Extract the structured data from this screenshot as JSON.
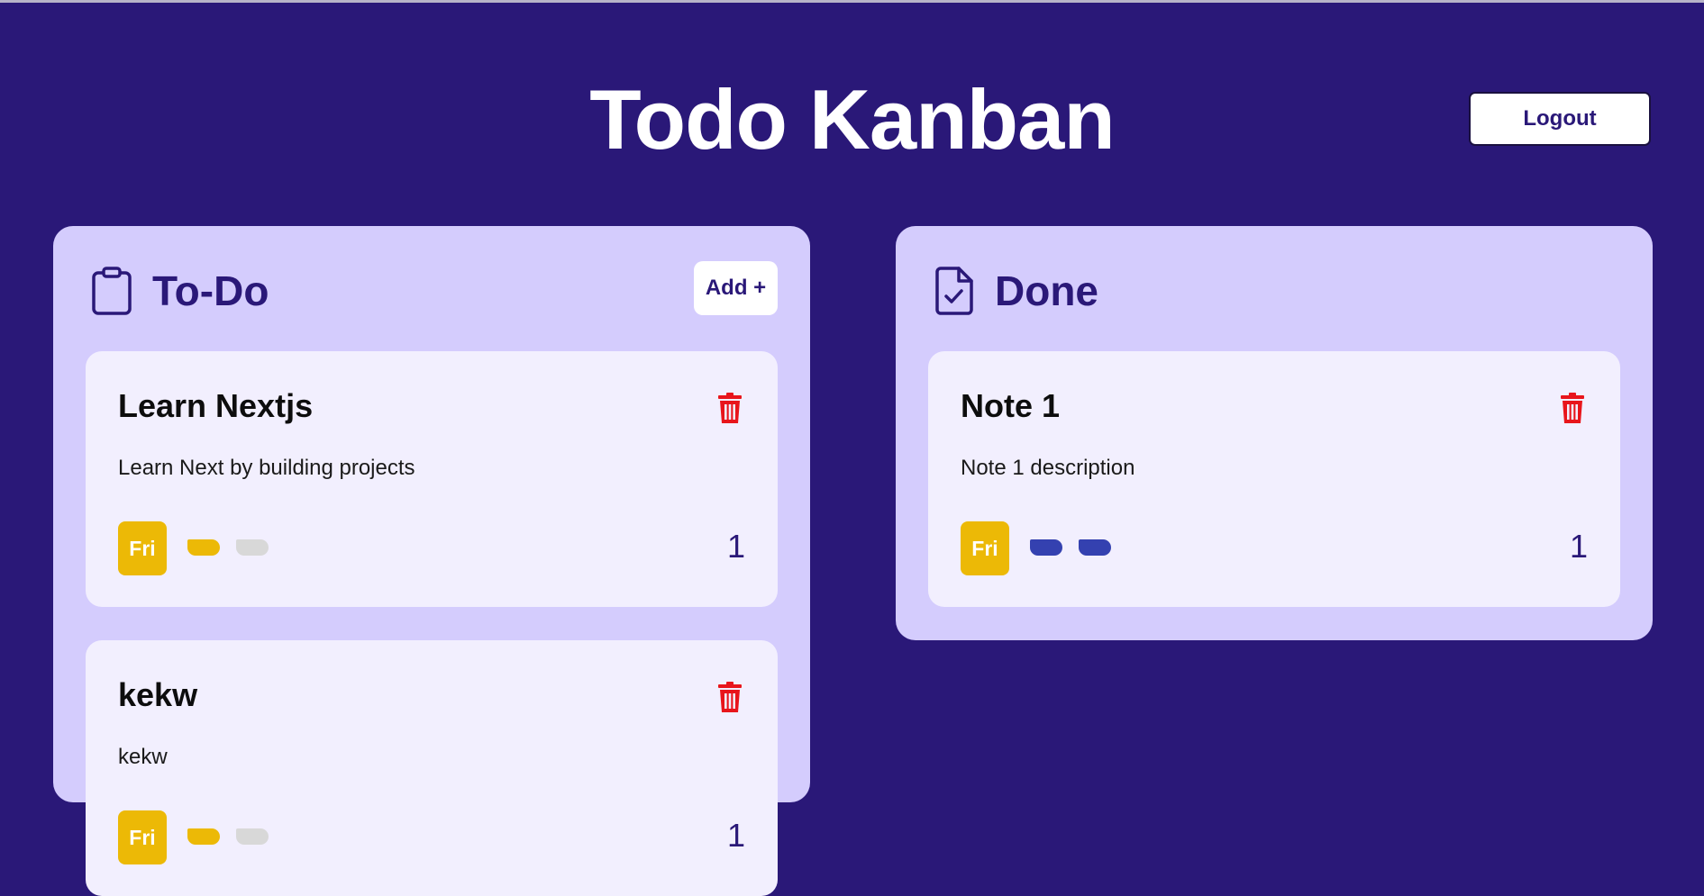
{
  "header": {
    "title": "Todo Kanban",
    "logout_label": "Logout"
  },
  "colors": {
    "background": "#2a1878",
    "column": "#d4ccfd",
    "card": "#f2effe",
    "accent": "#2a1878",
    "day_badge": "#ecb906",
    "delete": "#e8151b",
    "pill_yellow": "#ecb906",
    "pill_grey": "#d8d8d8",
    "pill_blue": "#3441b0"
  },
  "columns": [
    {
      "title": "To-Do",
      "icon": "clipboard-icon",
      "add_label": "Add +",
      "cards": [
        {
          "title": "Learn Nextjs",
          "description": "Learn Next by building projects",
          "day": "Fri",
          "count": "1",
          "pills": [
            "#ecb906",
            "#d8d8d8"
          ]
        },
        {
          "title": "kekw",
          "description": "kekw",
          "day": "Fri",
          "count": "1",
          "pills": [
            "#ecb906",
            "#d8d8d8"
          ]
        }
      ]
    },
    {
      "title": "Done",
      "icon": "file-check-icon",
      "cards": [
        {
          "title": "Note 1",
          "description": "Note 1 description",
          "day": "Fri",
          "count": "1",
          "pills": [
            "#3441b0",
            "#3441b0"
          ]
        }
      ]
    }
  ]
}
